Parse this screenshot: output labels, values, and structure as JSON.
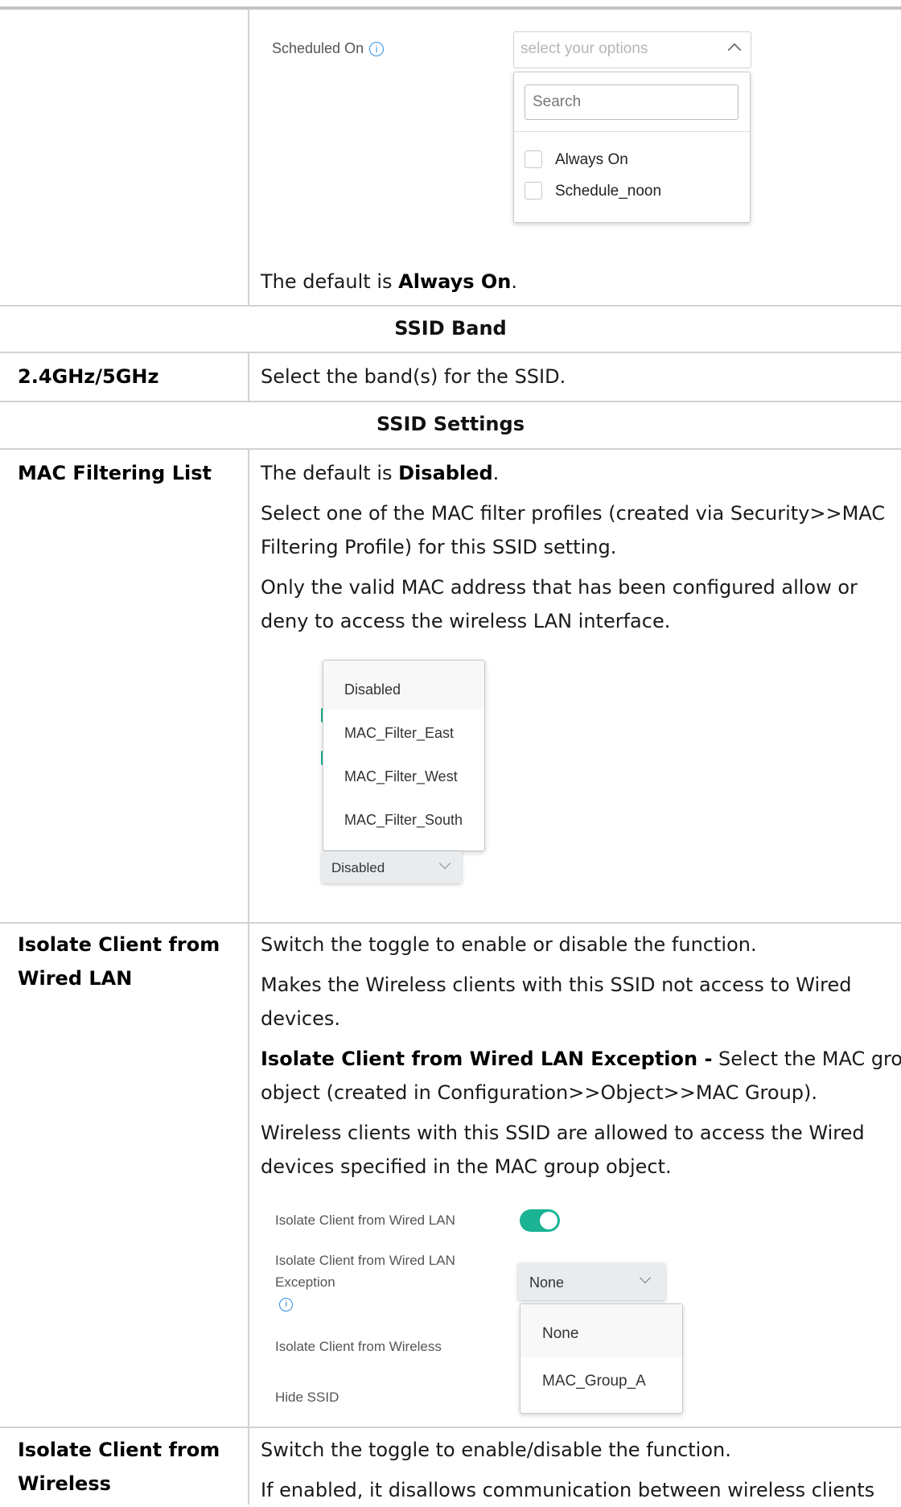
{
  "schedule": {
    "label": "Scheduled On",
    "select_placeholder": "select your options",
    "search_placeholder": "Search",
    "options": [
      "Always On",
      "Schedule_noon"
    ],
    "default_prefix": "The default is ",
    "default_value": "Always On",
    "default_suffix": "."
  },
  "ssid_band": {
    "heading": "SSID Band",
    "label": "2.4GHz/5GHz",
    "description": "Select the band(s) for the SSID."
  },
  "ssid_settings": {
    "heading": "SSID Settings"
  },
  "mac_filter": {
    "label": "MAC Filtering List",
    "default_prefix": "The default is ",
    "default_value": "Disabled",
    "default_suffix": ".",
    "desc1_line1": "Select one of the MAC filter profiles (created via Security>>MAC",
    "desc1_line2": "Filtering Profile) for this SSID setting.",
    "desc2_line1": "Only the valid MAC address that has been configured allow or",
    "desc2_line2": "deny to access the wireless LAN interface.",
    "options": [
      "Disabled",
      "MAC_Filter_East",
      "MAC_Filter_West",
      "MAC_Filter_South"
    ],
    "selected": "Disabled"
  },
  "isolate_wired": {
    "label_line1": "Isolate Client from",
    "label_line2": "Wired LAN",
    "desc1": "Switch the toggle to enable or disable the function.",
    "desc2_line1": "Makes the Wireless clients with this SSID not access to Wired",
    "desc2_line2": "devices.",
    "exception_bold": "Isolate Client from Wired LAN Exception -",
    "exception_rest": " Select the MAC group",
    "exception_line2": "object (created in Configuration>>Object>>MAC Group).",
    "desc4_line1": "Wireless clients with this SSID are allowed to access the Wired",
    "desc4_line2": "devices specified in the MAC group object.",
    "ui": {
      "row1": "Isolate Client from Wired LAN",
      "row2_line1": "Isolate Client from Wired LAN",
      "row2_line2": "Exception",
      "row3": "Isolate Client from Wireless",
      "row4": "Hide SSID",
      "toggle_on": true,
      "accent": "#1ab394",
      "selected": "None",
      "options": [
        "None",
        "MAC_Group_A"
      ]
    }
  },
  "isolate_wireless": {
    "label_line1": "Isolate Client from",
    "label_line2": "Wireless",
    "desc1": "Switch the toggle to enable/disable the function.",
    "desc2": "If enabled, it disallows communication between wireless clients"
  }
}
